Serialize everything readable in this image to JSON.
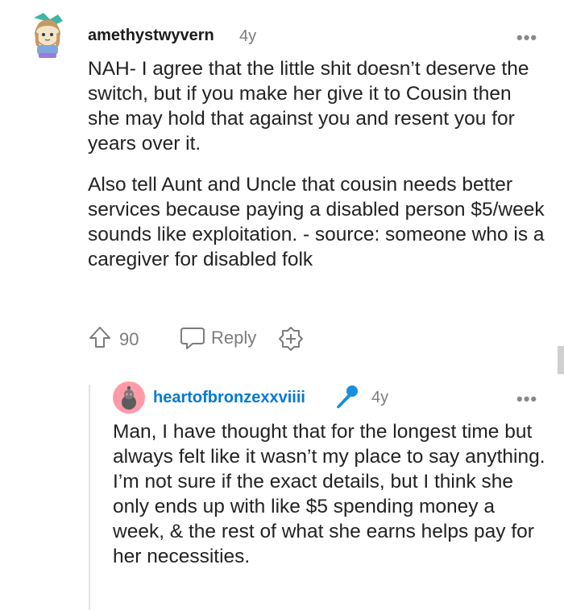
{
  "comment": {
    "username": "amethystwyvern",
    "age": "4y",
    "more_label": "•••",
    "paragraphs": [
      "NAH- I agree that the little shit doesn’t deserve the switch, but if you make her give it to Cousin then she may hold that against you and resent you for years over it.",
      "Also tell Aunt and Uncle that cousin needs better services because paying a disabled person $5/week sounds like exploitation. - source: someone who is a caregiver for disabled folk"
    ],
    "upvote_count": "90",
    "reply_label": "Reply"
  },
  "reply": {
    "username": "heartofbronzexxviiii",
    "age": "4y",
    "more_label": "•••",
    "body": "Man, I have thought that for the longest time but always felt like it wasn’t my place to say anything. I’m not sure if the exact details, but I think she only ends up with like $5 spending money a week, & the rest of what she earns helps pay for her necessities."
  },
  "colors": {
    "username_reply": "#0079d3",
    "mic_badge": "#1a8fdb",
    "avatar_reply_bg": "#ff9aa6",
    "meta_gray": "#7c7c7c"
  },
  "icons": {
    "upvote": "upvote-arrow-icon",
    "reply": "speech-bubble-icon",
    "award": "plus-award-icon",
    "badge": "microphone-icon"
  }
}
